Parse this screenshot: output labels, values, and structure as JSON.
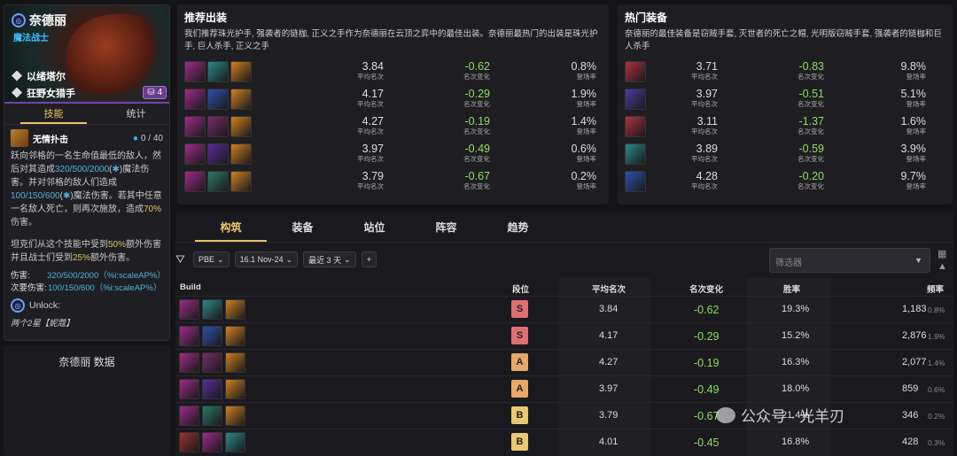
{
  "champion": {
    "name": "奈德丽",
    "role": "魔法战士",
    "traits": [
      "以绪塔尔",
      "狂野女猎手"
    ],
    "cost": "4",
    "tabs": [
      "技能",
      "统计"
    ],
    "skill_name": "无情扑击",
    "mana": "0 / 40",
    "description_parts": {
      "p1": "跃向邻格的一名生命值最低的敌人，然后对其造成",
      "p1_val": "320/500/2000",
      "p1_end": "魔法伤害。并对邻格的敌人们造成",
      "p2_val": "100/150/600",
      "p2_end": "魔法伤害。若其中任意一名敌人死亡，则再次施放，造成",
      "p2_pct": "70%",
      "p2_tail": "伤害。",
      "p3": "坦克们从这个技能中受到",
      "p3_pct": "50%",
      "p3_mid": "额外伤害并且战士们受到",
      "p3_pct2": "25%",
      "p3_end": "额外伤害。"
    },
    "stats": [
      {
        "k": "伤害:",
        "v": "320/500/2000（%i:scaleAP%）"
      },
      {
        "k": "次要伤害:",
        "v": "100/150/600（%i:scaleAP%）"
      }
    ],
    "unlock_label": "Unlock:",
    "unlock_note": "两个2星【妮蔻】",
    "data_title": "奈德丽 数据"
  },
  "recommended": {
    "title": "推荐出装",
    "desc": "我们推荐珠光护手, 强袭者的链枷, 正义之手作为奈德丽在云顶之弈中的最佳出装。奈德丽最热门的出装是珠光护手, 巨人杀手, 正义之手",
    "rows": [
      {
        "avg": "3.84",
        "chg": "-0.62",
        "rate": "0.8%",
        "items": [
          "#a02a8a",
          "#2a8a8a",
          "#d08020"
        ]
      },
      {
        "avg": "4.17",
        "chg": "-0.29",
        "rate": "1.9%",
        "items": [
          "#a02a8a",
          "#2a50b0",
          "#d08020"
        ]
      },
      {
        "avg": "4.27",
        "chg": "-0.19",
        "rate": "1.4%",
        "items": [
          "#a02a8a",
          "#7a2a6a",
          "#d08020"
        ]
      },
      {
        "avg": "3.97",
        "chg": "-0.49",
        "rate": "0.6%",
        "items": [
          "#a02a8a",
          "#5a2aa0",
          "#d08020"
        ]
      },
      {
        "avg": "3.79",
        "chg": "-0.67",
        "rate": "0.2%",
        "items": [
          "#a02a8a",
          "#2a7a6a",
          "#d08020"
        ]
      }
    ]
  },
  "hot": {
    "title": "热门装备",
    "desc": "奈德丽的最佳装备是窃贼手套, 灭世者的死亡之帽, 光明版窃贼手套, 强袭者的链枷和巨人杀手",
    "rows": [
      {
        "avg": "3.71",
        "chg": "-0.83",
        "rate": "9.8%",
        "color": "#b03040"
      },
      {
        "avg": "3.97",
        "chg": "-0.51",
        "rate": "5.1%",
        "color": "#4a3aa0"
      },
      {
        "avg": "3.11",
        "chg": "-1.37",
        "rate": "1.6%",
        "color": "#b03040"
      },
      {
        "avg": "3.89",
        "chg": "-0.59",
        "rate": "3.9%",
        "color": "#2a8a8a"
      },
      {
        "avg": "4.28",
        "chg": "-0.20",
        "rate": "9.7%",
        "color": "#2a50b0"
      }
    ]
  },
  "labels": {
    "avg": "平均名次",
    "chg": "名次变化",
    "rate": "登场率"
  },
  "tabs": [
    "构筑",
    "装备",
    "站位",
    "阵容",
    "趋势"
  ],
  "filters": {
    "pbe": "PBE",
    "patch": "16.1 Nov-24",
    "days": "最近 3 天",
    "plus": "+",
    "search_placeholder": "筛选器"
  },
  "table": {
    "headers": [
      "Build",
      "段位",
      "平均名次",
      "名次变化",
      "胜率",
      "频率"
    ],
    "rows": [
      {
        "tier": "S",
        "avg": "3.84",
        "chg": "-0.62",
        "win": "19.3%",
        "freq": "1,183",
        "pct": "0.8%"
      },
      {
        "tier": "S",
        "avg": "4.17",
        "chg": "-0.29",
        "win": "15.2%",
        "freq": "2,876",
        "pct": "1.9%"
      },
      {
        "tier": "A",
        "avg": "4.27",
        "chg": "-0.19",
        "win": "16.3%",
        "freq": "2,077",
        "pct": "1.4%"
      },
      {
        "tier": "A",
        "avg": "3.97",
        "chg": "-0.49",
        "win": "18.0%",
        "freq": "859",
        "pct": "0.6%"
      },
      {
        "tier": "B",
        "avg": "3.79",
        "chg": "-0.67",
        "win": "21.4%",
        "freq": "346",
        "pct": "0.2%"
      },
      {
        "tier": "B",
        "avg": "4.01",
        "chg": "-0.45",
        "win": "16.8%",
        "freq": "428",
        "pct": "0.3%"
      }
    ]
  },
  "tier_colors": {
    "S": "#e07070",
    "A": "#e8a868",
    "B": "#e8c870"
  },
  "watermark": "公众号 · 光羊刃"
}
